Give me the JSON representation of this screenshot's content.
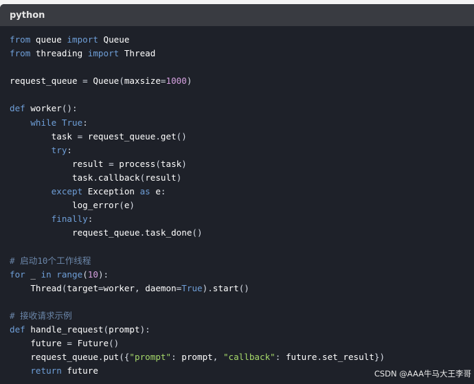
{
  "code_block": {
    "language": "python",
    "lines": [
      [
        {
          "t": "from",
          "c": "kw"
        },
        {
          "t": " queue ",
          "c": "fn"
        },
        {
          "t": "import",
          "c": "kw"
        },
        {
          "t": " Queue",
          "c": "fn"
        }
      ],
      [
        {
          "t": "from",
          "c": "kw"
        },
        {
          "t": " threading ",
          "c": "fn"
        },
        {
          "t": "import",
          "c": "kw"
        },
        {
          "t": " Thread",
          "c": "fn"
        }
      ],
      [],
      [
        {
          "t": "request_queue ",
          "c": "fn"
        },
        {
          "t": "=",
          "c": "pc"
        },
        {
          "t": " Queue",
          "c": "fn"
        },
        {
          "t": "(",
          "c": "pc"
        },
        {
          "t": "maxsize",
          "c": "fn"
        },
        {
          "t": "=",
          "c": "pc"
        },
        {
          "t": "1000",
          "c": "nu"
        },
        {
          "t": ")",
          "c": "pc"
        }
      ],
      [],
      [
        {
          "t": "def",
          "c": "kw"
        },
        {
          "t": " worker",
          "c": "fn"
        },
        {
          "t": "():",
          "c": "pc"
        }
      ],
      [
        {
          "t": "    "
        },
        {
          "t": "while",
          "c": "kw"
        },
        {
          "t": " "
        },
        {
          "t": "True",
          "c": "kw"
        },
        {
          "t": ":",
          "c": "pc"
        }
      ],
      [
        {
          "t": "        task ",
          "c": "fn"
        },
        {
          "t": "=",
          "c": "pc"
        },
        {
          "t": " request_queue",
          "c": "fn"
        },
        {
          "t": ".",
          "c": "pc"
        },
        {
          "t": "get",
          "c": "fn"
        },
        {
          "t": "()",
          "c": "pc"
        }
      ],
      [
        {
          "t": "        "
        },
        {
          "t": "try",
          "c": "kw"
        },
        {
          "t": ":",
          "c": "pc"
        }
      ],
      [
        {
          "t": "            result ",
          "c": "fn"
        },
        {
          "t": "=",
          "c": "pc"
        },
        {
          "t": " process",
          "c": "fn"
        },
        {
          "t": "(",
          "c": "pc"
        },
        {
          "t": "task",
          "c": "fn"
        },
        {
          "t": ")",
          "c": "pc"
        }
      ],
      [
        {
          "t": "            task",
          "c": "fn"
        },
        {
          "t": ".",
          "c": "pc"
        },
        {
          "t": "callback",
          "c": "fn"
        },
        {
          "t": "(",
          "c": "pc"
        },
        {
          "t": "result",
          "c": "fn"
        },
        {
          "t": ")",
          "c": "pc"
        }
      ],
      [
        {
          "t": "        "
        },
        {
          "t": "except",
          "c": "kw"
        },
        {
          "t": " Exception ",
          "c": "fn"
        },
        {
          "t": "as",
          "c": "kw"
        },
        {
          "t": " e",
          "c": "fn"
        },
        {
          "t": ":",
          "c": "pc"
        }
      ],
      [
        {
          "t": "            log_error",
          "c": "fn"
        },
        {
          "t": "(",
          "c": "pc"
        },
        {
          "t": "e",
          "c": "fn"
        },
        {
          "t": ")",
          "c": "pc"
        }
      ],
      [
        {
          "t": "        "
        },
        {
          "t": "finally",
          "c": "kw"
        },
        {
          "t": ":",
          "c": "pc"
        }
      ],
      [
        {
          "t": "            request_queue",
          "c": "fn"
        },
        {
          "t": ".",
          "c": "pc"
        },
        {
          "t": "task_done",
          "c": "fn"
        },
        {
          "t": "()",
          "c": "pc"
        }
      ],
      [],
      [
        {
          "t": "# 启动10个工作线程",
          "c": "cm"
        }
      ],
      [
        {
          "t": "for",
          "c": "kw"
        },
        {
          "t": " _ ",
          "c": "fn"
        },
        {
          "t": "in",
          "c": "kw"
        },
        {
          "t": " "
        },
        {
          "t": "range",
          "c": "kw"
        },
        {
          "t": "(",
          "c": "pc"
        },
        {
          "t": "10",
          "c": "nu"
        },
        {
          "t": "):",
          "c": "pc"
        }
      ],
      [
        {
          "t": "    Thread",
          "c": "fn"
        },
        {
          "t": "(",
          "c": "pc"
        },
        {
          "t": "target",
          "c": "fn"
        },
        {
          "t": "=",
          "c": "pc"
        },
        {
          "t": "worker",
          "c": "fn"
        },
        {
          "t": ", ",
          "c": "pc"
        },
        {
          "t": "daemon",
          "c": "fn"
        },
        {
          "t": "=",
          "c": "pc"
        },
        {
          "t": "True",
          "c": "kw"
        },
        {
          "t": ").",
          "c": "pc"
        },
        {
          "t": "start",
          "c": "fn"
        },
        {
          "t": "()",
          "c": "pc"
        }
      ],
      [],
      [
        {
          "t": "# 接收请求示例",
          "c": "cm"
        }
      ],
      [
        {
          "t": "def",
          "c": "kw"
        },
        {
          "t": " handle_request",
          "c": "fn"
        },
        {
          "t": "(",
          "c": "pc"
        },
        {
          "t": "prompt",
          "c": "fn"
        },
        {
          "t": "):",
          "c": "pc"
        }
      ],
      [
        {
          "t": "    future ",
          "c": "fn"
        },
        {
          "t": "=",
          "c": "pc"
        },
        {
          "t": " Future",
          "c": "fn"
        },
        {
          "t": "()",
          "c": "pc"
        }
      ],
      [
        {
          "t": "    request_queue",
          "c": "fn"
        },
        {
          "t": ".",
          "c": "pc"
        },
        {
          "t": "put",
          "c": "fn"
        },
        {
          "t": "({",
          "c": "pc"
        },
        {
          "t": "\"prompt\"",
          "c": "st"
        },
        {
          "t": ": ",
          "c": "pc"
        },
        {
          "t": "prompt",
          "c": "fn"
        },
        {
          "t": ", ",
          "c": "pc"
        },
        {
          "t": "\"callback\"",
          "c": "st"
        },
        {
          "t": ": ",
          "c": "pc"
        },
        {
          "t": "future",
          "c": "fn"
        },
        {
          "t": ".",
          "c": "pc"
        },
        {
          "t": "set_result",
          "c": "fn"
        },
        {
          "t": "})",
          "c": "pc"
        }
      ],
      [
        {
          "t": "    "
        },
        {
          "t": "return",
          "c": "kw"
        },
        {
          "t": " future",
          "c": "fn"
        }
      ]
    ]
  },
  "watermark": "CSDN @AAA牛马大王李哥"
}
